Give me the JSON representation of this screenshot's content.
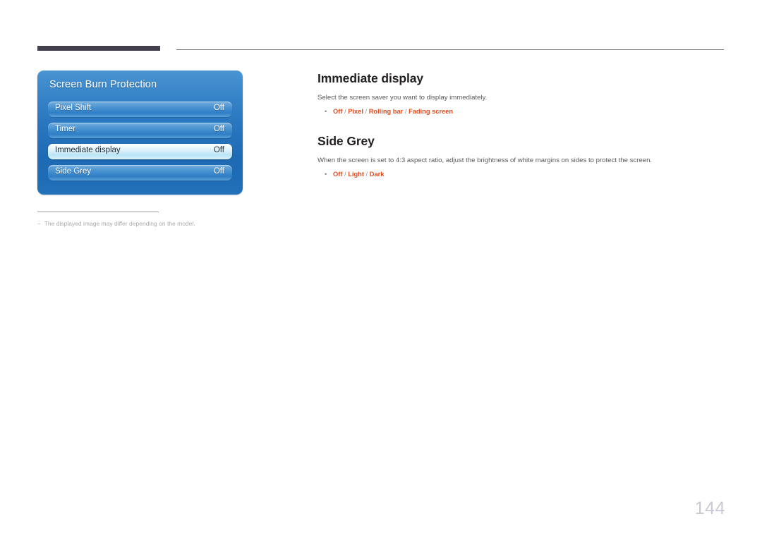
{
  "page": {
    "number": "144",
    "header_rule_style": "dark-bar-plus-thin-line"
  },
  "osd": {
    "title": "Screen Burn Protection",
    "rows": [
      {
        "label": "Pixel Shift",
        "value": "Off",
        "selected": false
      },
      {
        "label": "Timer",
        "value": "Off",
        "selected": false
      },
      {
        "label": "Immediate display",
        "value": "Off",
        "selected": true
      },
      {
        "label": "Side Grey",
        "value": "Off",
        "selected": false
      }
    ]
  },
  "footnote": {
    "dash": "–",
    "text": "The displayed image may differ depending on the model."
  },
  "content": {
    "sections": [
      {
        "heading": "Immediate display",
        "description": "Select the screen saver you want to display immediately.",
        "bullet_marker": "•",
        "options": [
          "Off",
          "Pixel",
          "Rolling bar",
          "Fading screen"
        ],
        "option_separator": "/"
      },
      {
        "heading": "Side Grey",
        "description": "When the screen is set to 4:3 aspect ratio, adjust the brightness of white margins on sides to protect the screen.",
        "bullet_marker": "•",
        "options": [
          "Off",
          "Light",
          "Dark"
        ],
        "option_separator": "/"
      }
    ]
  },
  "colors": {
    "accent_orange": "#e04e22",
    "body_text": "#58595b",
    "heading_text": "#231f20",
    "footnote_text": "#a7a9ac",
    "header_bar": "#433f4c",
    "page_number": "#c9c9d4",
    "osd_blue": "#2a77c0"
  }
}
